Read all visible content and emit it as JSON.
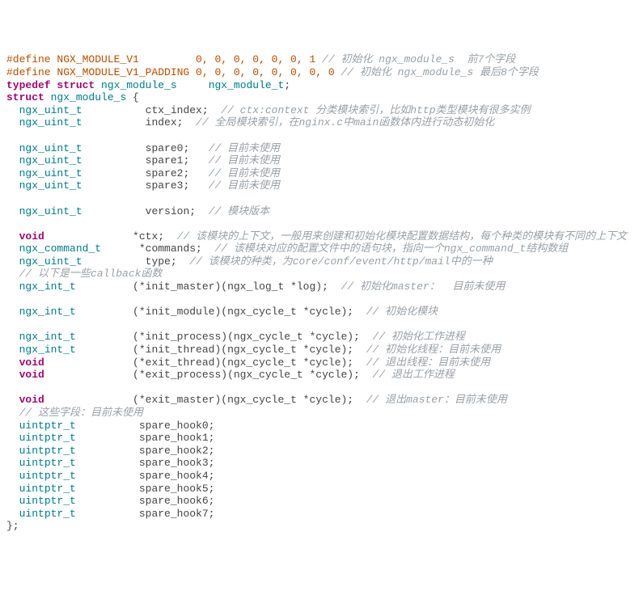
{
  "l1_def": "#define NGX_MODULE_V1         0, 0, 0, 0, 0, 0, 1 ",
  "l1_cm": "// 初始化 ngx_module_s  前7个字段",
  "l2_def": "#define NGX_MODULE_V1_PADDING 0, 0, 0, 0, 0, 0, 0, 0 ",
  "l2_cm": "// 初始化 ngx_module_s 最后8个字段",
  "l3_kw1": "typedef",
  "l3_kw2": "struct",
  "l3_ty1": "ngx_module_s",
  "l3_ty2": "ngx_module_t",
  "l4_kw": "struct",
  "l4_ty": "ngx_module_s",
  "l4_open": " {",
  "ty_uint": "ngx_uint_t",
  "ty_cmd": "ngx_command_t",
  "ty_int": "ngx_int_t",
  "ty_uptr": "uintptr_t",
  "kw_void": "void",
  "f_ctx_index": "ctx_index;",
  "cm_ctx_index": "// ctx:context 分类模块索引，比如http类型模块有很多实例",
  "f_index": "index;",
  "cm_index": "// 全局模块索引，在nginx.c中main函数体内进行动态初始化",
  "f_spare0": "spare0;",
  "f_spare1": "spare1;",
  "f_spare2": "spare2;",
  "f_spare3": "spare3;",
  "cm_unused": "// 目前未使用",
  "f_version": "version;",
  "cm_version": "// 模块版本",
  "f_ctx": "*ctx;",
  "cm_ctx": "// 该模块的上下文，一般用来创建和初始化模块配置数据结构，每个种类的模块有不同的上下文",
  "f_commands": "*commands;",
  "cm_commands": "// 该模块对应的配置文件中的语句块，指向一个ngx_command_t结构数组",
  "f_type": "type;",
  "cm_type": "// 该模块的种类，为core/conf/event/http/mail中的一种",
  "cm_callbacks": "// 以下是一些callback函数",
  "f_init_master": "(*init_master)(ngx_log_t *log);",
  "cm_init_master": "// 初始化master：  目前未使用",
  "f_init_module": "(*init_module)(ngx_cycle_t *cycle);",
  "cm_init_module": "// 初始化模块",
  "f_init_process": "(*init_process)(ngx_cycle_t *cycle);",
  "cm_init_process": "// 初始化工作进程",
  "f_init_thread": "(*init_thread)(ngx_cycle_t *cycle);",
  "cm_init_thread": "// 初始化线程：目前未使用",
  "f_exit_thread": "(*exit_thread)(ngx_cycle_t *cycle);",
  "cm_exit_thread": "// 退出线程：目前未使用",
  "f_exit_process": "(*exit_process)(ngx_cycle_t *cycle);",
  "cm_exit_process": "// 退出工作进程",
  "f_exit_master": "(*exit_master)(ngx_cycle_t *cycle);",
  "cm_exit_master": "// 退出master：目前未使用",
  "cm_fields_unused": "// 这些字段：目前未使用",
  "f_sh0": "spare_hook0;",
  "f_sh1": "spare_hook1;",
  "f_sh2": "spare_hook2;",
  "f_sh3": "spare_hook3;",
  "f_sh4": "spare_hook4;",
  "f_sh5": "spare_hook5;",
  "f_sh6": "spare_hook6;",
  "f_sh7": "spare_hook7;",
  "close": "};",
  "sp2": "  ",
  "sp_ty_field": "          ",
  "sp_fc": "  ",
  "gap_uint": "   ",
  "gap_void": "              ",
  "gap_cmd": "      ",
  "gap_int": "         ",
  "gap_uptr": "          ",
  "l3_sp1": " ",
  "l3_sp2": "     ",
  "l4_sp": " "
}
